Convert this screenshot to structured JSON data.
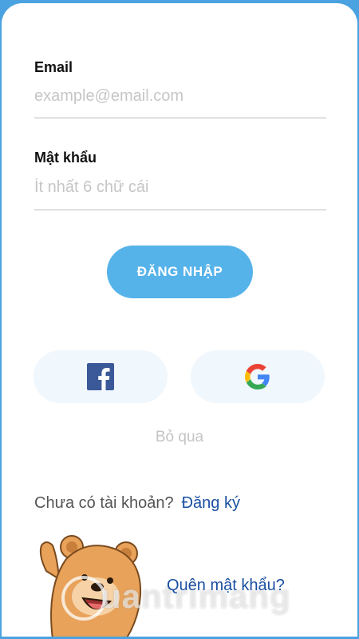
{
  "form": {
    "email_label": "Email",
    "email_placeholder": "example@email.com",
    "password_label": "Mật khẩu",
    "password_placeholder": "Ít nhất 6 chữ cái",
    "login_button": "ĐĂNG NHẬP"
  },
  "social": {
    "facebook_icon": "facebook-icon",
    "google_icon": "google-icon"
  },
  "skip_label": "Bỏ qua",
  "signup": {
    "prompt": "Chưa có tài khoản?",
    "link": "Đăng ký"
  },
  "forgot_password": "Quên mật khẩu?",
  "watermark": "uantrimang",
  "colors": {
    "accent": "#56b3ea",
    "link": "#1a4fa0",
    "facebook": "#3b5998"
  }
}
